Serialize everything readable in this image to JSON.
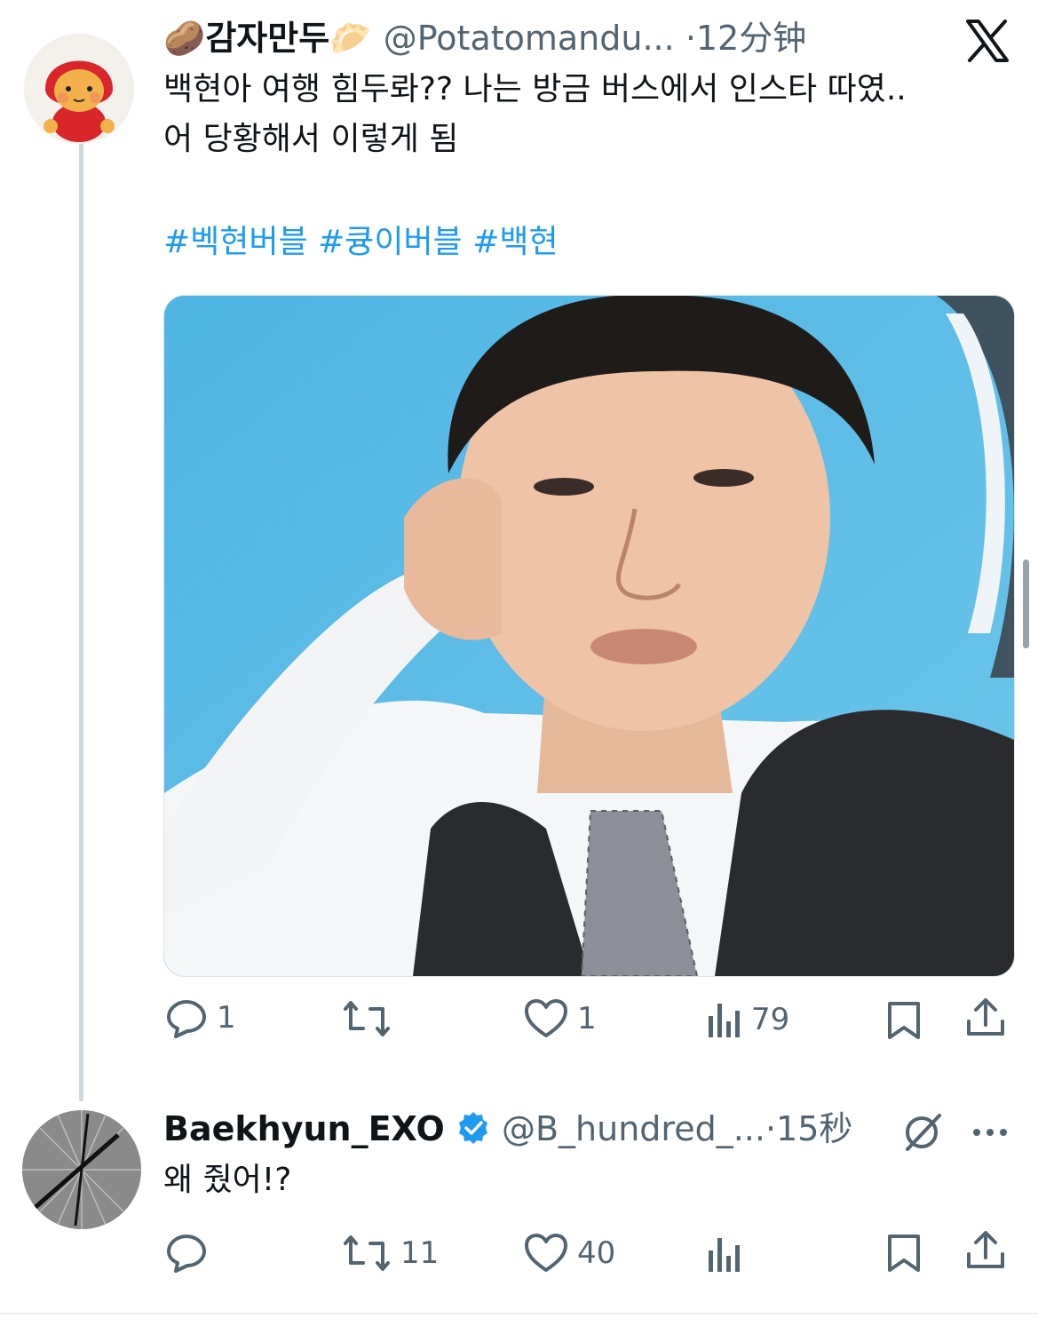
{
  "tweet1": {
    "name_emoji_left": "🥔",
    "display_name": "감자만두",
    "name_emoji_right": "🥟",
    "handle": "@Potatomandu...",
    "separator": "·",
    "time": "12分钟",
    "text_line1": "백현아 여행 힘두롸?? 나는 방금 버스에서 인스타 따였..",
    "text_line2": "어 당황해서 이렇게 됨",
    "hashtags": [
      "#벡현버블",
      "#큥이버블",
      "#백현"
    ],
    "actions": {
      "replies": "1",
      "retweets": "",
      "likes": "1",
      "views": "79"
    }
  },
  "tweet2": {
    "display_name": "Baekhyun_EXO",
    "handle": "@B_hundred_...",
    "separator": "·",
    "time": "15秒",
    "text": "왜 줬어!?",
    "actions": {
      "replies": "",
      "retweets": "11",
      "likes": "40",
      "views": ""
    }
  },
  "colors": {
    "accent": "#1d9bf0",
    "muted": "#536471",
    "text": "#0f1419",
    "verified": "#1d9bf0"
  },
  "icons": [
    "x-logo-icon",
    "reply-icon",
    "retweet-icon",
    "like-icon",
    "views-icon",
    "bookmark-icon",
    "share-icon",
    "verified-badge-icon",
    "grok-icon",
    "more-icon"
  ]
}
